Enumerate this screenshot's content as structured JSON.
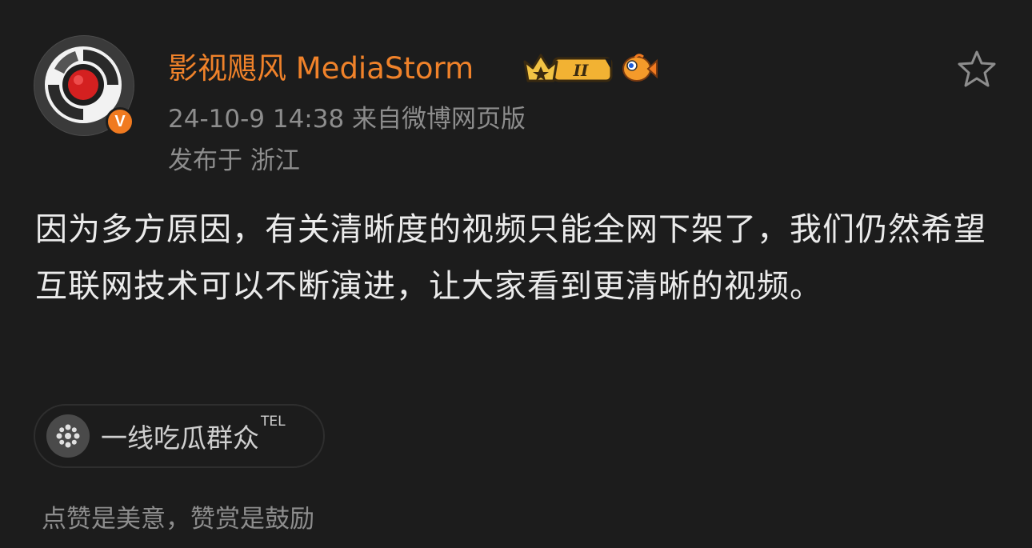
{
  "user": {
    "name": "影视飓风 MediaStorm",
    "verified_label": "V",
    "level_badge": "II",
    "brand_color": "#f0822a"
  },
  "meta": {
    "time_source": "24-10-9 14:38  来自微博网页版",
    "location": "发布于 浙江"
  },
  "post": {
    "text": "因为多方原因，有关清晰度的视频只能全网下架了，我们仍然希望互联网技术可以不断演进，让大家看到更清晰的视频。"
  },
  "group": {
    "name": "一线吃瓜群众",
    "tag": "TEL",
    "icon": "flower-icon"
  },
  "footer": {
    "text": "点赞是美意，赞赏是鼓励"
  },
  "icons": {
    "favorite": "star-outline-icon",
    "crown": "crown-icon",
    "fish": "fish-icon"
  }
}
